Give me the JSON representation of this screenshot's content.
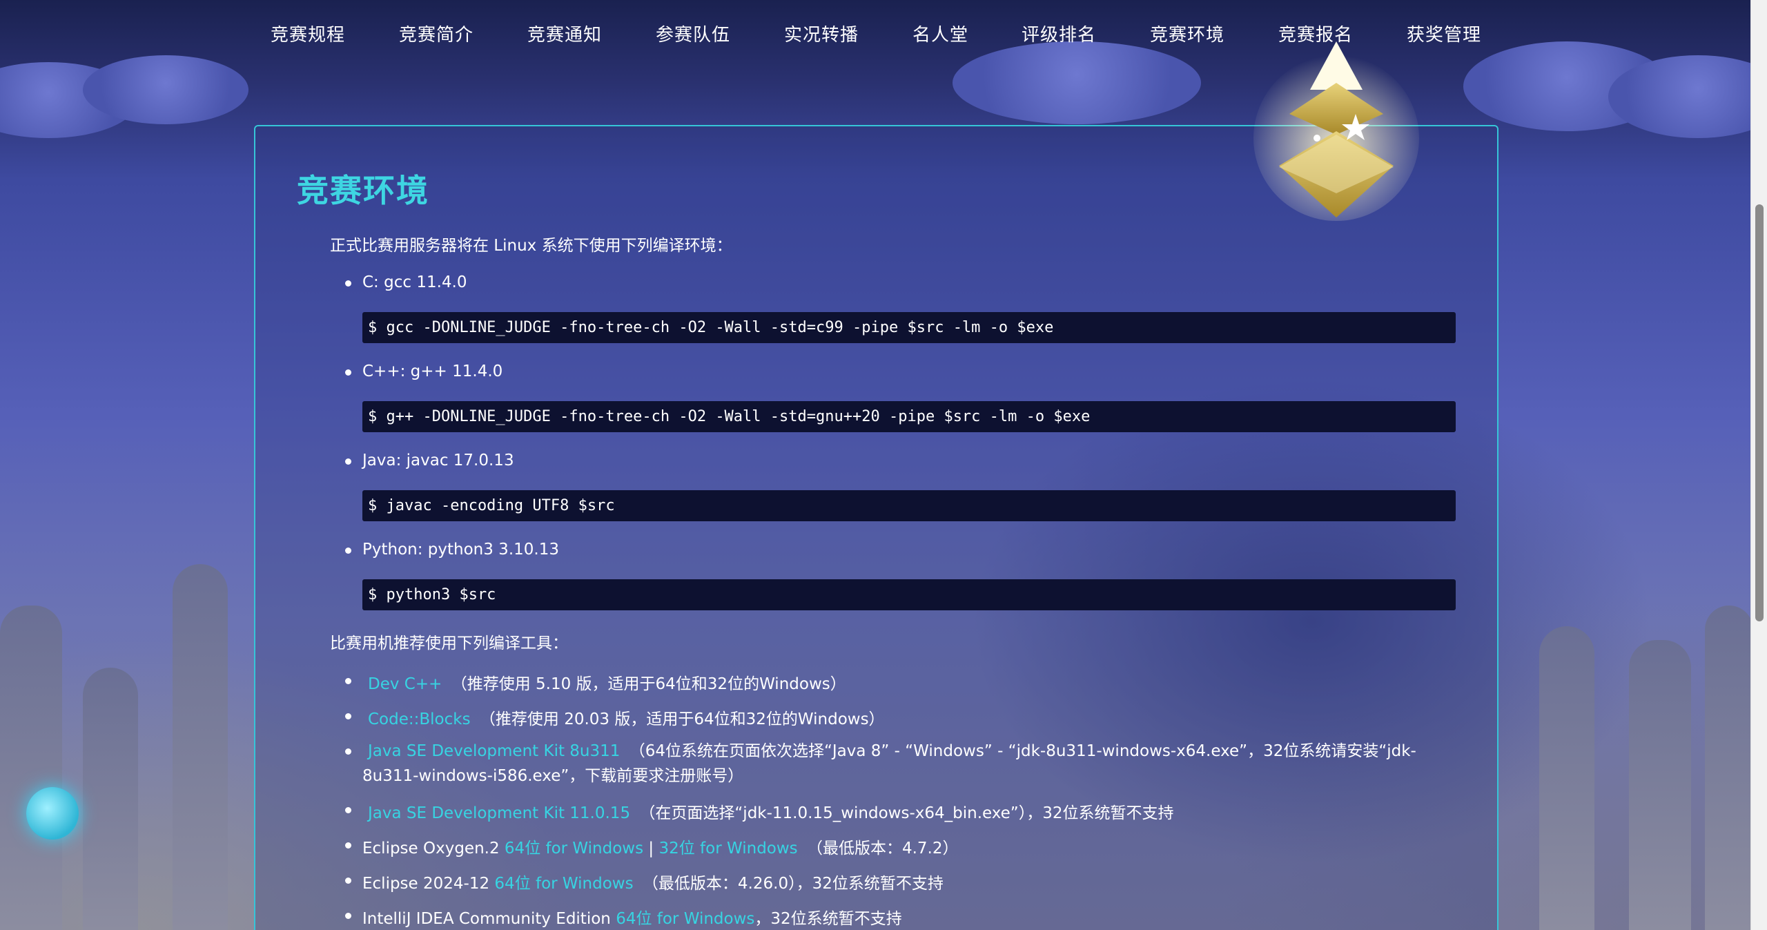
{
  "nav": {
    "items": [
      "竞赛规程",
      "竞赛简介",
      "竞赛通知",
      "参赛队伍",
      "实况转播",
      "名人堂",
      "评级排名",
      "竞赛环境",
      "竞赛报名",
      "获奖管理"
    ],
    "active": "竞赛环境"
  },
  "page": {
    "title": "竞赛环境",
    "intro": "正式比赛用服务器将在 Linux 系统下使用下列编译环境：",
    "compilers": [
      {
        "label": "C: gcc 11.4.0",
        "command": "$ gcc -DONLINE_JUDGE -fno-tree-ch -O2 -Wall -std=c99 -pipe $src -lm -o $exe"
      },
      {
        "label": "C++: g++ 11.4.0",
        "command": "$ g++ -DONLINE_JUDGE -fno-tree-ch -O2 -Wall -std=gnu++20 -pipe $src -lm -o $exe"
      },
      {
        "label": "Java: javac 17.0.13",
        "command": "$ javac -encoding UTF8 $src"
      },
      {
        "label": "Python: python3 3.10.13",
        "command": "$ python3 $src"
      }
    ],
    "tools_intro": "比赛用机推荐使用下列编译工具：",
    "tools": [
      {
        "link": "Dev C++",
        "text": "（推荐使用 5.10 版，适用于64位和32位的Windows）"
      },
      {
        "link": "Code::Blocks",
        "text": "（推荐使用 20.03 版，适用于64位和32位的Windows）"
      },
      {
        "link": "Java SE Development Kit 8u311",
        "text": "（64位系统在页面依次选择“Java 8” - “Windows” - “jdk-8u311-windows-x64.exe”，32位系统请安装“jdk-8u311-windows-i586.exe”，下载前要求注册账号）"
      },
      {
        "link": "Java SE Development Kit 11.0.15",
        "text": "（在页面选择“jdk-11.0.15_windows-x64_bin.exe”），32位系统暂不支持"
      },
      {
        "prefix": "Eclipse Oxygen.2 ",
        "link": "64位 for Windows",
        "sep": " | ",
        "link2": "32位 for Windows",
        "text": "（最低版本：4.7.2）"
      },
      {
        "prefix": "Eclipse 2024-12 ",
        "link": "64位 for Windows",
        "text": "（最低版本：4.26.0），32位系统暂不支持"
      },
      {
        "prefix": "IntelliJ IDEA Community Edition ",
        "link": "64位 for Windows",
        "text": "，32位系统暂不支持"
      }
    ]
  },
  "colors": {
    "accent": "#37d4e2",
    "title": "#3ed6e2",
    "code_bg": "#0d1130",
    "panel_border": "#36c6d8"
  },
  "icons": {
    "badge": "gold-pyramid-star-badge-icon"
  }
}
